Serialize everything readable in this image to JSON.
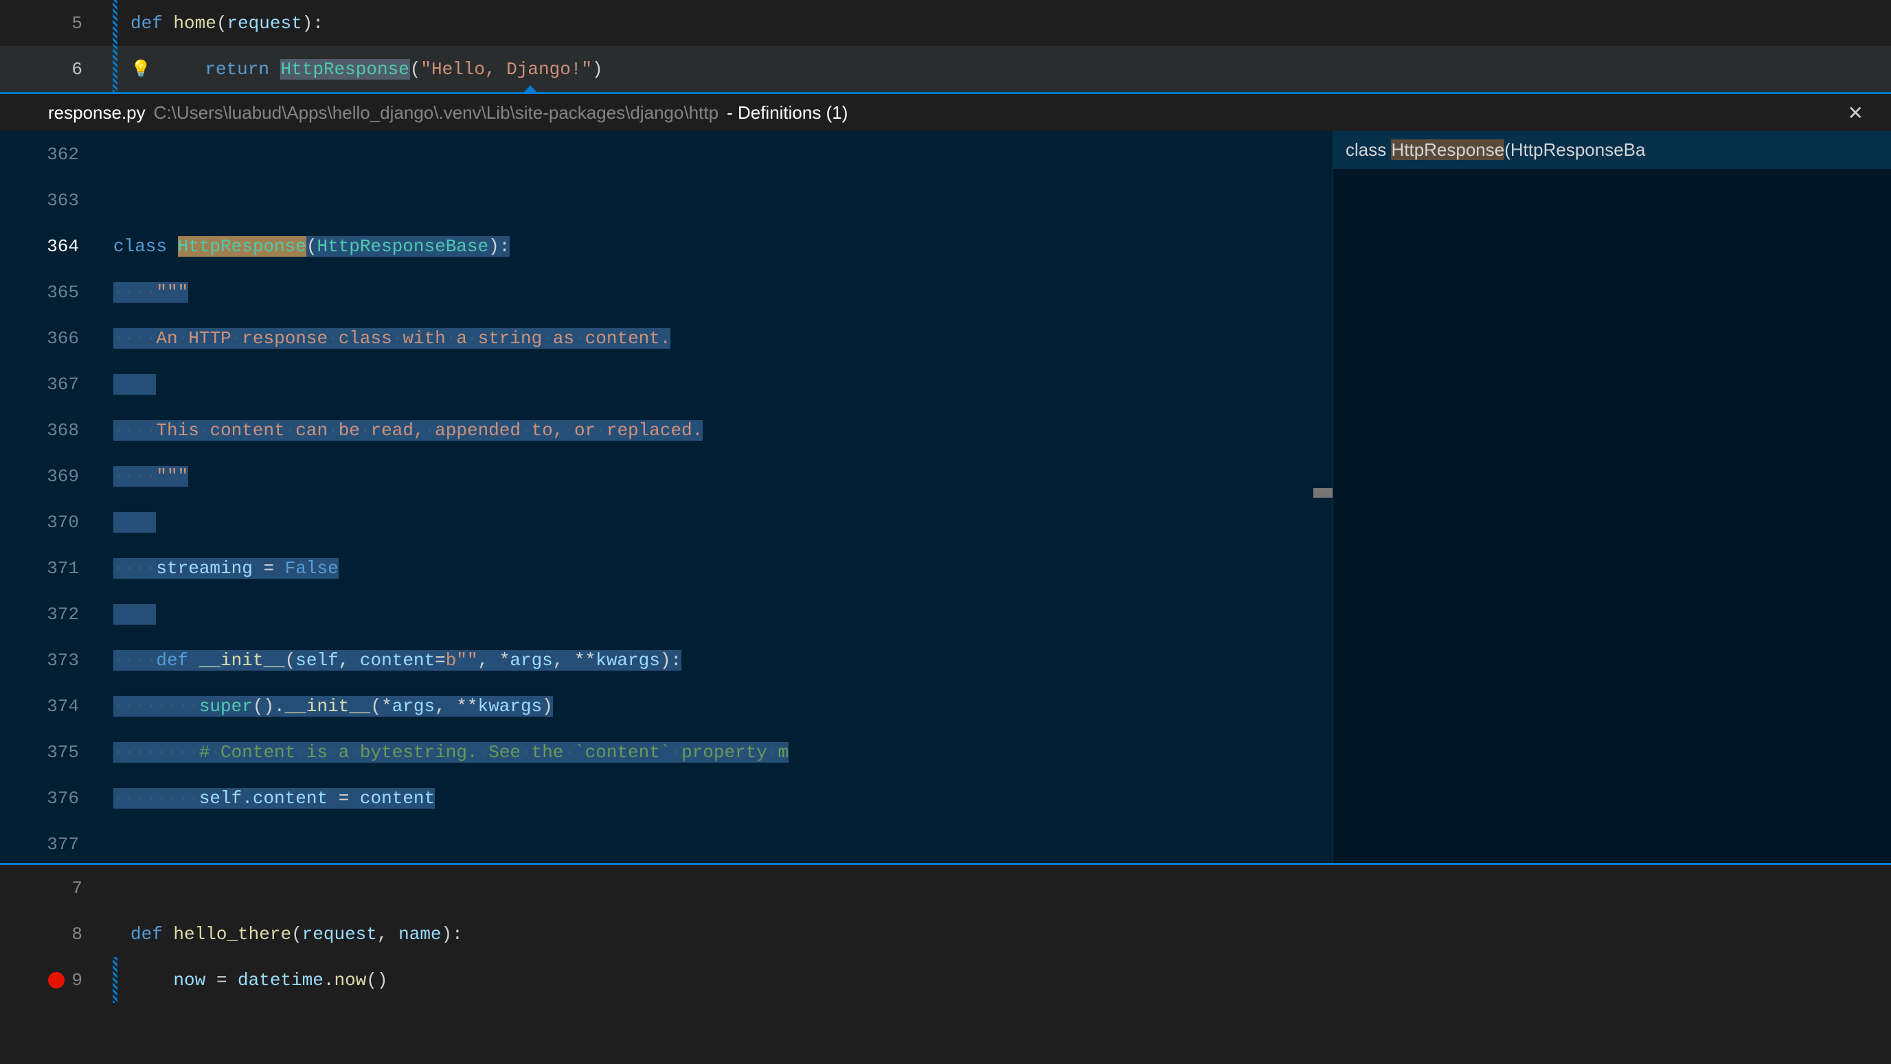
{
  "editor": {
    "top_lines": [
      {
        "num": "5",
        "modified": true,
        "tokens": [
          {
            "t": "def ",
            "c": "kw"
          },
          {
            "t": "home",
            "c": "fn"
          },
          {
            "t": "(",
            "c": "punct"
          },
          {
            "t": "request",
            "c": "var"
          },
          {
            "t": "):",
            "c": "punct"
          }
        ]
      },
      {
        "num": "6",
        "modified": true,
        "active": true,
        "lightbulb": true,
        "highlight": true,
        "tokens": [
          {
            "t": "    ",
            "c": ""
          },
          {
            "t": "return ",
            "c": "kw"
          },
          {
            "t": "HttpResponse",
            "c": "cls",
            "sel": true
          },
          {
            "t": "(",
            "c": "punct"
          },
          {
            "t": "\"Hello, Django!\"",
            "c": "str"
          },
          {
            "t": ")",
            "c": "punct"
          }
        ]
      }
    ],
    "bottom_lines": [
      {
        "num": "7",
        "tokens": []
      },
      {
        "num": "8",
        "tokens": [
          {
            "t": "def ",
            "c": "kw"
          },
          {
            "t": "hello_there",
            "c": "fn"
          },
          {
            "t": "(",
            "c": "punct"
          },
          {
            "t": "request",
            "c": "var"
          },
          {
            "t": ", ",
            "c": "punct"
          },
          {
            "t": "name",
            "c": "var"
          },
          {
            "t": "):",
            "c": "punct"
          }
        ]
      },
      {
        "num": "9",
        "modified": true,
        "breakpoint": true,
        "tokens": [
          {
            "t": "    now ",
            "c": "var"
          },
          {
            "t": "= ",
            "c": "op"
          },
          {
            "t": "datetime",
            "c": "var"
          },
          {
            "t": ".",
            "c": "punct"
          },
          {
            "t": "now",
            "c": "fn"
          },
          {
            "t": "()",
            "c": "punct"
          }
        ]
      }
    ]
  },
  "peek": {
    "filename": "response.py",
    "path": "C:\\Users\\luabud\\Apps\\hello_django\\.venv\\Lib\\site-packages\\django\\http",
    "results_label": " - Definitions (1)",
    "sidebar_item_prefix": "class ",
    "sidebar_item_highlight": "HttpResponse",
    "sidebar_item_suffix": "(HttpResponseBa",
    "lines": [
      {
        "num": "362",
        "tokens": []
      },
      {
        "num": "363",
        "tokens": []
      },
      {
        "num": "364",
        "current": true,
        "tokens": [
          {
            "t": "class ",
            "c": "kw"
          },
          {
            "t": "HttpResponse",
            "c": "cls",
            "hl": true
          },
          {
            "t": "(",
            "c": "punct",
            "sel": true
          },
          {
            "t": "HttpResponseBase",
            "c": "cls",
            "sel": true
          },
          {
            "t": "):",
            "c": "punct",
            "sel": true
          }
        ]
      },
      {
        "num": "365",
        "tokens": [
          {
            "t": "····",
            "c": "ws-dot",
            "sel": true
          },
          {
            "t": "\"\"\"",
            "c": "str",
            "sel": true
          }
        ]
      },
      {
        "num": "366",
        "tokens": [
          {
            "t": "····",
            "c": "ws-dot",
            "sel": true
          },
          {
            "t": "An·HTTP·response·class·with·a·string·as·content.",
            "c": "str",
            "sel": true,
            "dots": true
          }
        ]
      },
      {
        "num": "367",
        "tokens": [
          {
            "t": "    ",
            "c": "",
            "sel": true
          }
        ]
      },
      {
        "num": "368",
        "tokens": [
          {
            "t": "····",
            "c": "ws-dot",
            "sel": true
          },
          {
            "t": "This·content·can·be·read,·appended·to,·or·replaced.",
            "c": "str",
            "sel": true,
            "dots": true
          }
        ]
      },
      {
        "num": "369",
        "tokens": [
          {
            "t": "····",
            "c": "ws-dot",
            "sel": true
          },
          {
            "t": "\"\"\"",
            "c": "str",
            "sel": true
          }
        ]
      },
      {
        "num": "370",
        "tokens": [
          {
            "t": "    ",
            "c": "",
            "sel": true
          }
        ]
      },
      {
        "num": "371",
        "tokens": [
          {
            "t": "····",
            "c": "ws-dot",
            "sel": true
          },
          {
            "t": "streaming",
            "c": "var",
            "sel": true
          },
          {
            "t": " = ",
            "c": "op",
            "sel": true
          },
          {
            "t": "False",
            "c": "const",
            "sel": true
          }
        ]
      },
      {
        "num": "372",
        "tokens": [
          {
            "t": "    ",
            "c": "",
            "sel": true
          }
        ]
      },
      {
        "num": "373",
        "tokens": [
          {
            "t": "····",
            "c": "ws-dot",
            "sel": true
          },
          {
            "t": "def ",
            "c": "kw",
            "sel": true
          },
          {
            "t": "__init__",
            "c": "fn",
            "sel": true
          },
          {
            "t": "(",
            "c": "punct",
            "sel": true
          },
          {
            "t": "self",
            "c": "var",
            "sel": true
          },
          {
            "t": ", ",
            "c": "punct",
            "sel": true
          },
          {
            "t": "content",
            "c": "var",
            "sel": true
          },
          {
            "t": "=",
            "c": "op",
            "sel": true
          },
          {
            "t": "b\"\"",
            "c": "str",
            "sel": true
          },
          {
            "t": ", *",
            "c": "punct",
            "sel": true
          },
          {
            "t": "args",
            "c": "var",
            "sel": true
          },
          {
            "t": ", **",
            "c": "punct",
            "sel": true
          },
          {
            "t": "kwargs",
            "c": "var",
            "sel": true
          },
          {
            "t": "):",
            "c": "punct",
            "sel": true
          }
        ]
      },
      {
        "num": "374",
        "tokens": [
          {
            "t": "········",
            "c": "ws-dot",
            "sel": true
          },
          {
            "t": "super",
            "c": "cls",
            "sel": true
          },
          {
            "t": "().",
            "c": "punct",
            "sel": true
          },
          {
            "t": "__init__",
            "c": "fn",
            "sel": true
          },
          {
            "t": "(*",
            "c": "punct",
            "sel": true
          },
          {
            "t": "args",
            "c": "var",
            "sel": true
          },
          {
            "t": ", **",
            "c": "punct",
            "sel": true
          },
          {
            "t": "kwargs",
            "c": "var",
            "sel": true
          },
          {
            "t": ")",
            "c": "punct",
            "sel": true
          }
        ]
      },
      {
        "num": "375",
        "tokens": [
          {
            "t": "········",
            "c": "ws-dot",
            "sel": true
          },
          {
            "t": "#·Content·is·a·bytestring.·See·the·`content`·property·m",
            "c": "comment",
            "sel": true,
            "dots": true
          }
        ]
      },
      {
        "num": "376",
        "tokens": [
          {
            "t": "········",
            "c": "ws-dot",
            "sel": true
          },
          {
            "t": "self",
            "c": "var",
            "sel": true
          },
          {
            "t": ".content ",
            "c": "var",
            "sel": true
          },
          {
            "t": "= ",
            "c": "op",
            "sel": true
          },
          {
            "t": "content",
            "c": "var",
            "sel": true
          }
        ]
      },
      {
        "num": "377",
        "tokens": []
      }
    ]
  }
}
